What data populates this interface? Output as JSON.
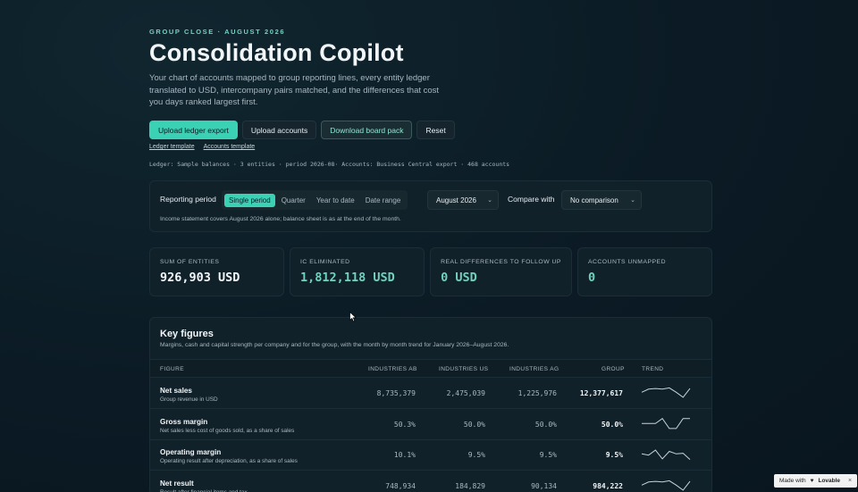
{
  "header": {
    "eyebrow": "GROUP CLOSE · AUGUST 2026",
    "title": "Consolidation Copilot",
    "intro": "Your chart of accounts mapped to group reporting lines, every entity ledger translated to USD, intercompany pairs matched, and the differences that cost you days ranked largest first."
  },
  "actions": {
    "upload_ledger": "Upload ledger export",
    "upload_accounts": "Upload accounts",
    "download_board_pack": "Download board pack",
    "reset": "Reset",
    "ledger_template": "Ledger template",
    "accounts_template": "Accounts template"
  },
  "meta_line": "Ledger: Sample balances · 3 entities · period 2026-08· Accounts: Business Central export · 468 accounts",
  "period": {
    "label": "Reporting period",
    "options": [
      "Single period",
      "Quarter",
      "Year to date",
      "Date range"
    ],
    "selected_month": "August 2026",
    "compare_label": "Compare with",
    "compare_value": "No comparison",
    "note": "Income statement covers August 2026 alone; balance sheet is as at the end of the month."
  },
  "kpis": [
    {
      "label": "SUM OF ENTITIES",
      "value": "926,903 USD"
    },
    {
      "label": "IC ELIMINATED",
      "value": "1,812,118 USD"
    },
    {
      "label": "REAL DIFFERENCES TO FOLLOW UP",
      "value": "0 USD"
    },
    {
      "label": "ACCOUNTS UNMAPPED",
      "value": "0"
    }
  ],
  "key_figures": {
    "title": "Key figures",
    "subtitle": "Margins, cash and capital strength per company and for the group, with the month by month trend for January 2026–August 2026.",
    "columns": [
      "FIGURE",
      "INDUSTRIES AB",
      "INDUSTRIES US",
      "INDUSTRIES AG",
      "GROUP",
      "TREND"
    ],
    "rows": [
      {
        "name": "Net sales",
        "desc": "Group revenue in USD",
        "ab": "8,735,379",
        "us": "2,475,039",
        "ag": "1,225,976",
        "group": "12,377,617",
        "trend": [
          0.55,
          0.8,
          0.85,
          0.8,
          0.9,
          0.55,
          0.15,
          0.85
        ]
      },
      {
        "name": "Gross margin",
        "desc": "Net sales less cost of goods sold, as a share of sales",
        "ab": "50.3%",
        "us": "50.0%",
        "ag": "50.0%",
        "group": "50.0%",
        "trend": [
          0.55,
          0.55,
          0.55,
          0.95,
          0.15,
          0.15,
          0.95,
          0.95
        ]
      },
      {
        "name": "Operating margin",
        "desc": "Operating result after depreciation, as a share of sales",
        "ab": "10.1%",
        "us": "9.5%",
        "ag": "9.5%",
        "group": "9.5%",
        "trend": [
          0.55,
          0.45,
          0.85,
          0.15,
          0.75,
          0.55,
          0.6,
          0.1
        ]
      },
      {
        "name": "Net result",
        "desc": "Result after financial items and tax",
        "ab": "748,934",
        "us": "184,829",
        "ag": "90,134",
        "group": "984,222",
        "trend": [
          0.55,
          0.8,
          0.85,
          0.8,
          0.9,
          0.55,
          0.15,
          0.85
        ]
      }
    ]
  },
  "badge": {
    "made_with": "Made with",
    "brand": "Lovable",
    "close": "×"
  },
  "colors": {
    "accent": "#3ad1b4",
    "background": "#0b1a24",
    "panel": "#11212a"
  }
}
